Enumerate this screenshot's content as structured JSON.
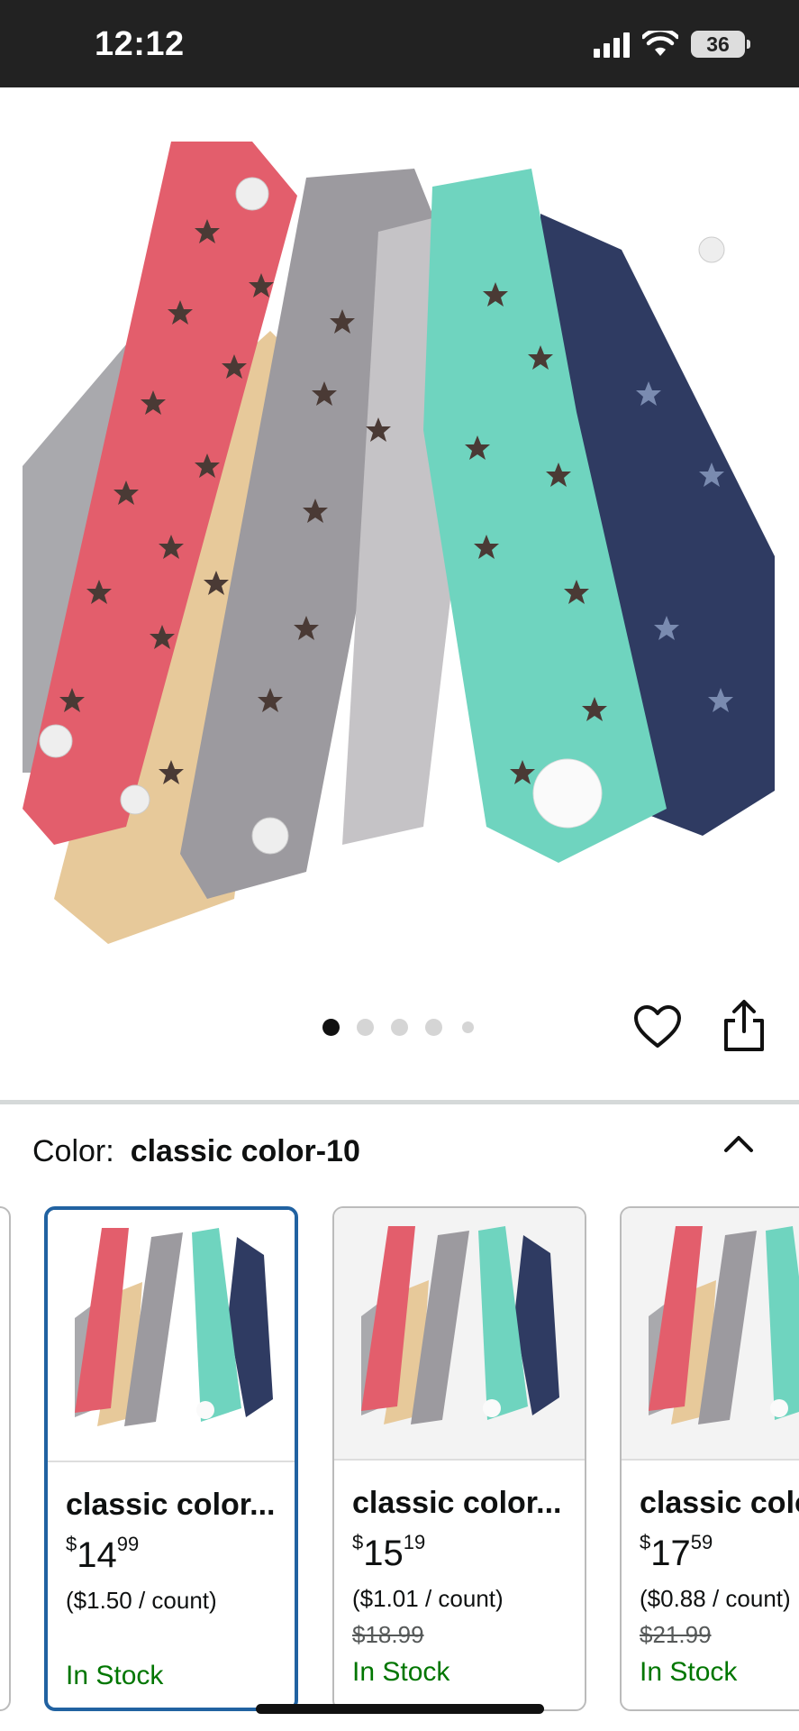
{
  "status_bar": {
    "time": "12:12",
    "battery": "36",
    "icons": [
      "signal-icon",
      "wifi-icon",
      "battery-icon"
    ]
  },
  "product": {
    "hero_image": "product-image-hair-curler-rods",
    "carousel": {
      "total": 5,
      "active": 1
    },
    "actions": [
      "heart-icon",
      "share-icon"
    ]
  },
  "variation": {
    "label": "Color:",
    "selected": "classic color-10",
    "toggle_icon": "chevron-up-icon"
  },
  "swatches": [
    {
      "name": "classic color...",
      "price_dollars": "14",
      "price_cents": "99",
      "currency": "$",
      "unit_price": "($1.50 / count)",
      "was_price": "",
      "stock": "In Stock",
      "selected": true
    },
    {
      "name": "classic color...",
      "price_dollars": "15",
      "price_cents": "19",
      "currency": "$",
      "unit_price": "($1.01 / count)",
      "was_price": "$18.99",
      "stock": "In Stock",
      "selected": false
    },
    {
      "name": "classic colo",
      "price_dollars": "17",
      "price_cents": "59",
      "currency": "$",
      "unit_price": "($0.88 / count)",
      "was_price": "$21.99",
      "stock": "In Stock",
      "selected": false
    }
  ],
  "colors": {
    "accent_selected": "#2162a1",
    "in_stock": "#007600",
    "status_bar": "#222222"
  }
}
